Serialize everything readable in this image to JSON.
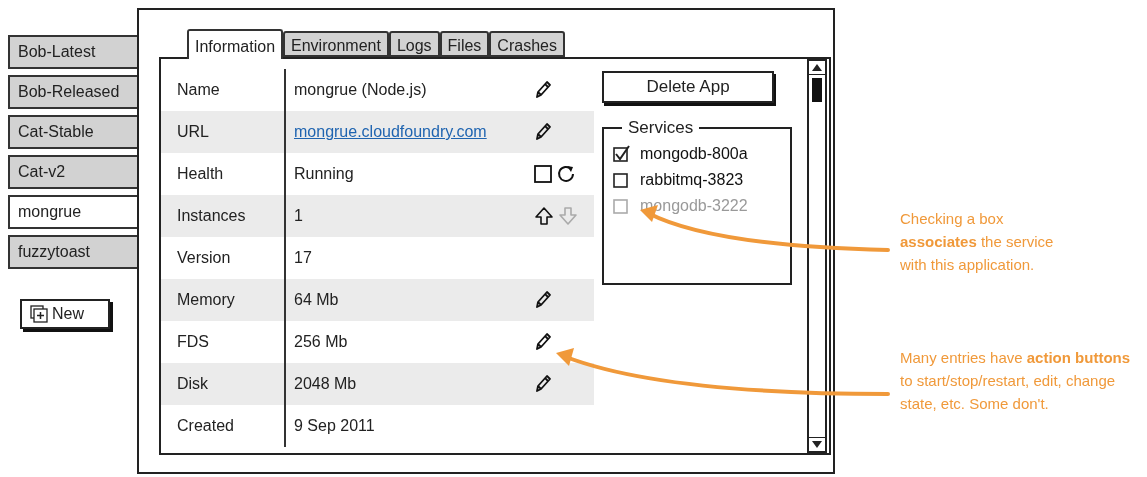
{
  "sidebar": {
    "items": [
      {
        "label": "Bob-Latest",
        "selected": false
      },
      {
        "label": "Bob-Released",
        "selected": false
      },
      {
        "label": "Cat-Stable",
        "selected": false
      },
      {
        "label": "Cat-v2",
        "selected": false
      },
      {
        "label": "mongrue",
        "selected": true
      },
      {
        "label": "fuzzytoast",
        "selected": false
      }
    ],
    "new_button": "New"
  },
  "tabs": [
    {
      "label": "Information",
      "selected": true
    },
    {
      "label": "Environment",
      "selected": false
    },
    {
      "label": "Logs",
      "selected": false
    },
    {
      "label": "Files",
      "selected": false
    },
    {
      "label": "Crashes",
      "selected": false
    }
  ],
  "table": {
    "rows": [
      {
        "label": "Name",
        "value": "mongrue (Node.js)",
        "kind": "text",
        "actions": [
          {
            "kind": "edit",
            "disabled": false
          }
        ]
      },
      {
        "label": "URL",
        "value": "mongrue.cloudfoundry.com",
        "kind": "link",
        "actions": [
          {
            "kind": "edit",
            "disabled": false
          }
        ]
      },
      {
        "label": "Health",
        "value": "Running",
        "kind": "text",
        "actions": [
          {
            "kind": "stop",
            "disabled": false
          },
          {
            "kind": "restart",
            "disabled": false
          }
        ]
      },
      {
        "label": "Instances",
        "value": "1",
        "kind": "text",
        "actions": [
          {
            "kind": "up",
            "disabled": false
          },
          {
            "kind": "down",
            "disabled": true
          }
        ]
      },
      {
        "label": "Version",
        "value": "17",
        "kind": "text",
        "actions": []
      },
      {
        "label": "Memory",
        "value": "64 Mb",
        "kind": "text",
        "actions": [
          {
            "kind": "edit",
            "disabled": false
          }
        ]
      },
      {
        "label": "FDS",
        "value": "256 Mb",
        "kind": "text",
        "actions": [
          {
            "kind": "edit",
            "disabled": false
          }
        ]
      },
      {
        "label": "Disk",
        "value": "2048 Mb",
        "kind": "text",
        "actions": [
          {
            "kind": "edit",
            "disabled": false
          }
        ]
      },
      {
        "label": "Created",
        "value": "9 Sep 2011",
        "kind": "text",
        "actions": []
      }
    ]
  },
  "delete_button": "Delete App",
  "services": {
    "title": "Services",
    "items": [
      {
        "label": "mongodb-800a",
        "checked": true,
        "disabled": false
      },
      {
        "label": "rabbitmq-3823",
        "checked": false,
        "disabled": false
      },
      {
        "label": "mongodb-3222",
        "checked": false,
        "disabled": true
      }
    ]
  },
  "annotations": [
    {
      "text": "Checking a box **associates** the service with this application."
    },
    {
      "text": "Many entries have **action buttons** to start/stop/restart, edit, change state, etc. Some don't."
    }
  ]
}
